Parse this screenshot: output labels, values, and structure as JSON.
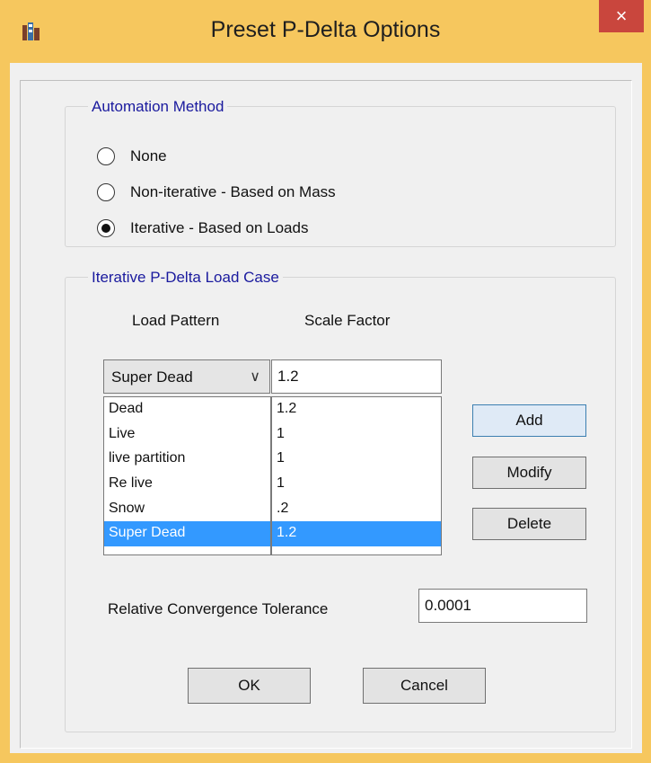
{
  "window": {
    "title": "Preset P-Delta Options",
    "close_glyph": "×"
  },
  "automation": {
    "legend": "Automation Method",
    "options": [
      {
        "label": "None",
        "checked": false
      },
      {
        "label": "Non-iterative - Based on Mass",
        "checked": false
      },
      {
        "label": "Iterative - Based on Loads",
        "checked": true
      }
    ]
  },
  "load_case": {
    "legend": "Iterative P-Delta Load Case",
    "col_load_pattern": "Load Pattern",
    "col_scale_factor": "Scale Factor",
    "selected_pattern": "Super Dead",
    "scale_factor_value": "1.2",
    "patterns": [
      "Dead",
      "Live",
      "live partition",
      "Re live",
      "Snow",
      "Super Dead"
    ],
    "factors": [
      "1.2",
      "1",
      "1",
      "1",
      ".2",
      "1.2"
    ],
    "selected_index": 5,
    "add_label": "Add",
    "modify_label": "Modify",
    "delete_label": "Delete"
  },
  "tolerance": {
    "label": "Relative Convergence Tolerance",
    "value": "0.0001"
  },
  "buttons": {
    "ok": "OK",
    "cancel": "Cancel"
  },
  "colors": {
    "titlebar": "#f6c75e",
    "close": "#c9463d",
    "legend": "#1a1a9e",
    "selection": "#3399ff"
  }
}
